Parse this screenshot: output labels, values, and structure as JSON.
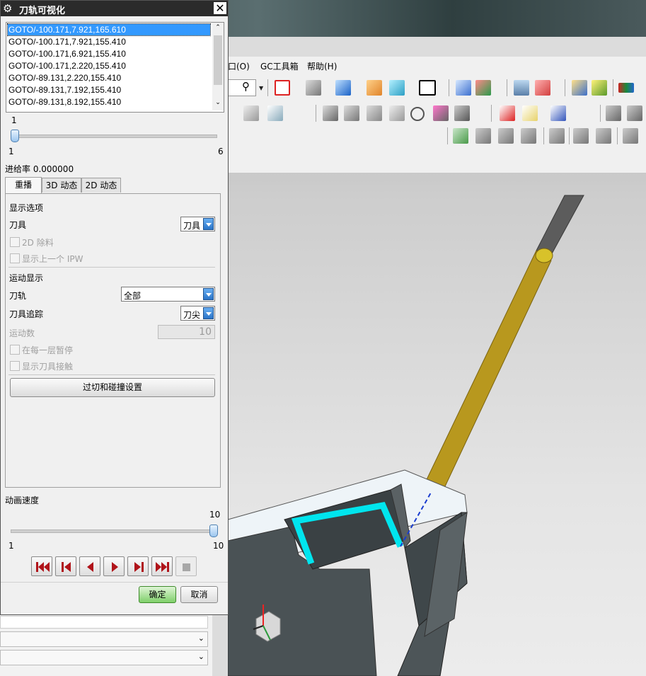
{
  "app": {
    "menu": [
      "口(O)",
      "GC工具箱",
      "帮助(H)"
    ]
  },
  "dialog": {
    "title": "刀轨可视化",
    "commands": [
      "GOTO/-100.171,7.921,165.610",
      "GOTO/-100.171,7.921,155.410",
      "GOTO/-100.171,6.921,155.410",
      "GOTO/-100.171,2.220,155.410",
      "GOTO/-89.131,2.220,155.410",
      "GOTO/-89.131,7.192,155.410",
      "GOTO/-89.131,8.192,155.410"
    ],
    "step_slider": {
      "current": "1",
      "min": "1",
      "max": "6",
      "value": 1
    },
    "feed_rate": "进给率 0.000000",
    "tabs": [
      "重播",
      "3D 动态",
      "2D 动态"
    ],
    "display_options": {
      "heading": "显示选项",
      "tool_label": "刀具",
      "tool_value": "刀具",
      "remove_2d": "2D 除料",
      "show_prev_ipw": "显示上一个 IPW"
    },
    "motion_display": {
      "heading": "运动显示",
      "path_label": "刀轨",
      "path_value": "全部",
      "trace_label": "刀具追踪",
      "trace_value": "刀尖",
      "motion_count_label": "运动数",
      "motion_count_value": "10",
      "pause_each_layer": "在每一层暂停",
      "show_tool_contact": "显示刀具接触"
    },
    "gouge_button": "过切和碰撞设置",
    "anim_speed": {
      "label": "动画速度",
      "current": "10",
      "min": "1",
      "max": "10",
      "value": 10
    },
    "ok": "确定",
    "cancel": "取消"
  },
  "colors": {
    "titlebar": "#2b2b2b",
    "selection": "#3399ff",
    "toolpath": "#00e5ee",
    "tool": "#b8981e",
    "ok_button": "#6ec25e"
  }
}
